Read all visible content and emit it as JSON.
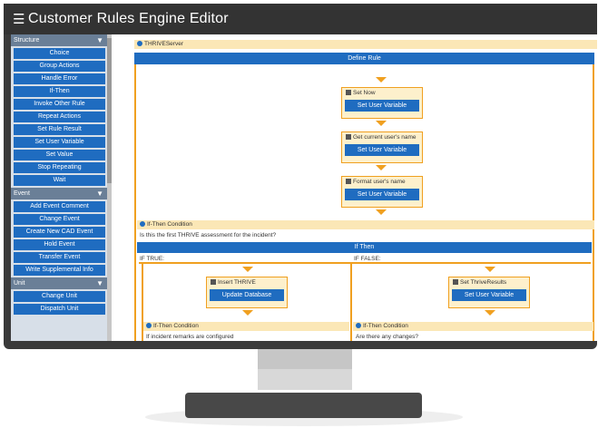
{
  "app": {
    "title": "Customer Rules Engine Editor",
    "menu_icon": "hamburger-icon"
  },
  "sidebar": {
    "sections": [
      {
        "label": "Structure",
        "items": [
          "Choice",
          "Group Actions",
          "Handle Error",
          "If-Then",
          "Invoke Other Rule",
          "Repeat Actions",
          "Set Rule Result",
          "Set User Variable",
          "Set Value",
          "Stop Repeating",
          "Wait"
        ]
      },
      {
        "label": "Event",
        "items": [
          "Add Event Comment",
          "Change Event",
          "Create New CAD Event",
          "Hold Event",
          "Transfer Event",
          "Write Supplemental Info"
        ]
      },
      {
        "label": "Unit",
        "items": [
          "Change Unit",
          "Dispatch Unit"
        ]
      }
    ]
  },
  "canvas": {
    "server_label": "THRIVEServer",
    "define_rule": "Define Rule",
    "steps": [
      {
        "label": "Set Now",
        "button": "Set User Variable"
      },
      {
        "label": "Get current user's name",
        "button": "Set User Variable"
      },
      {
        "label": "Format user's name",
        "button": "Set User Variable"
      }
    ],
    "if_then": {
      "header": "If-Then Condition",
      "question": "Is this the first THRIVE assessment for the incident?",
      "bar": "If Then",
      "if_true": "IF TRUE:",
      "if_false": "IF FALSE:",
      "true_step": {
        "label": "Insert THRIVE",
        "button": "Update Database"
      },
      "false_step": {
        "label": "Set ThriveResults",
        "button": "Set User Variable"
      },
      "true_nested": {
        "header": "If-Then Condition",
        "question": "If incident remarks are configured"
      },
      "false_nested": {
        "header": "If-Then Condition",
        "question": "Are there any changes?"
      }
    }
  },
  "colors": {
    "accent": "#1f6cc0",
    "gold": "#f0a020",
    "sidebar_header": "#6a7f97",
    "titlebar": "#333333"
  }
}
